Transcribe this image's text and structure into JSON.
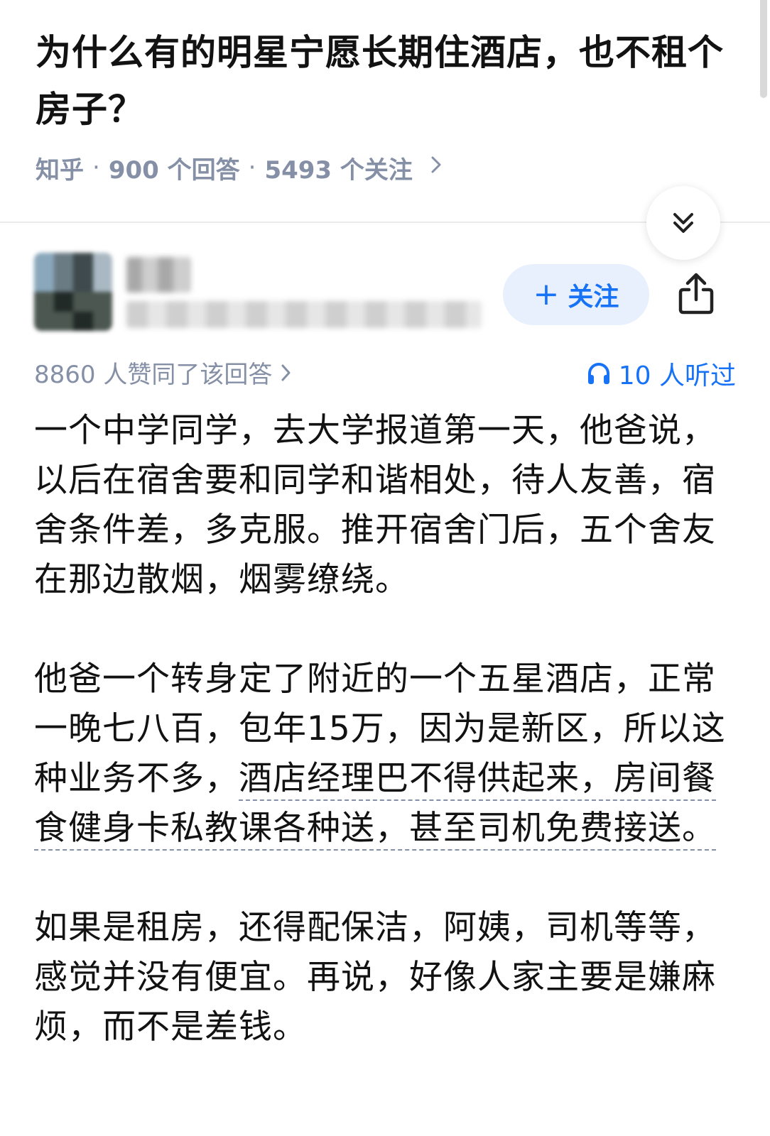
{
  "question": {
    "title": "为什么有的明星宁愿长期住酒店，也不租个房子？",
    "source": "知乎",
    "answers": "900 个回答",
    "followers": "5493 个关注"
  },
  "answer": {
    "follow_label": "关注",
    "upvote_text": "8860 人赞同了该回答",
    "listen_text": "10 人听过",
    "paragraphs": [
      {
        "plain": "一个中学同学，去大学报道第一天，他爸说，以后在宿舍要和同学和谐相处，待人友善，宿舍条件差，多克服。推开宿舍门后，五个舍友在那边散烟，烟雾缭绕。"
      },
      {
        "plain": "他爸一个转身定了附近的一个五星酒店，正常一晚七八百，包年15万，因为是新区，所以这种业务不多，",
        "link": "酒店经理巴不得供起来，房间餐食健身卡私教课各种送，甚至司机免费接送。"
      },
      {
        "plain": "如果是租房，还得配保洁，阿姨，司机等等，感觉并没有便宜。再说，好像人家主要是嫌麻烦，而不是差钱。"
      }
    ]
  },
  "colors": {
    "accent": "#1772f6",
    "meta": "#8590a6",
    "follow_bg": "#e8f0fd"
  }
}
